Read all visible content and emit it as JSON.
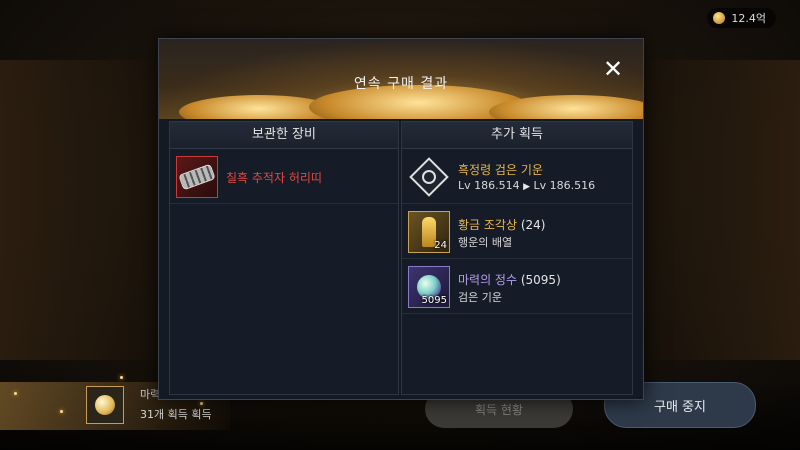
{
  "currency": {
    "amount": "12.4억"
  },
  "modal": {
    "title": "연속 구매 결과",
    "close_label": "✕",
    "left_panel": {
      "header": "보관한 장비",
      "items": [
        {
          "name": "칠흑 추적자 허리띠",
          "name_color": "#e04a42",
          "icon": "belt-icon"
        }
      ]
    },
    "right_panel": {
      "header": "추가 획득",
      "items": [
        {
          "name": "흑정령 검은 기운",
          "name_color": "#e7b54a",
          "sub_from": "Lv 186.514",
          "sub_arrow": "▶",
          "sub_to": "Lv 186.516",
          "icon": "black-spirit-icon"
        },
        {
          "name": "황금 조각상",
          "count": "(24)",
          "quantity": "24",
          "sub": "행운의 배열",
          "name_color": "#e7b54a",
          "icon": "golden-statue-icon"
        },
        {
          "name": "마력의 정수",
          "count": "(5095)",
          "quantity": "5095",
          "sub": "검은 기운",
          "name_color": "#b59cf0",
          "icon": "mana-essence-icon"
        }
      ]
    }
  },
  "bottom": {
    "acquire_title": "마력",
    "acquire_sub": "31개 획득 획득",
    "middle_button": "획득 현황",
    "stop_button": "구매 중지"
  }
}
